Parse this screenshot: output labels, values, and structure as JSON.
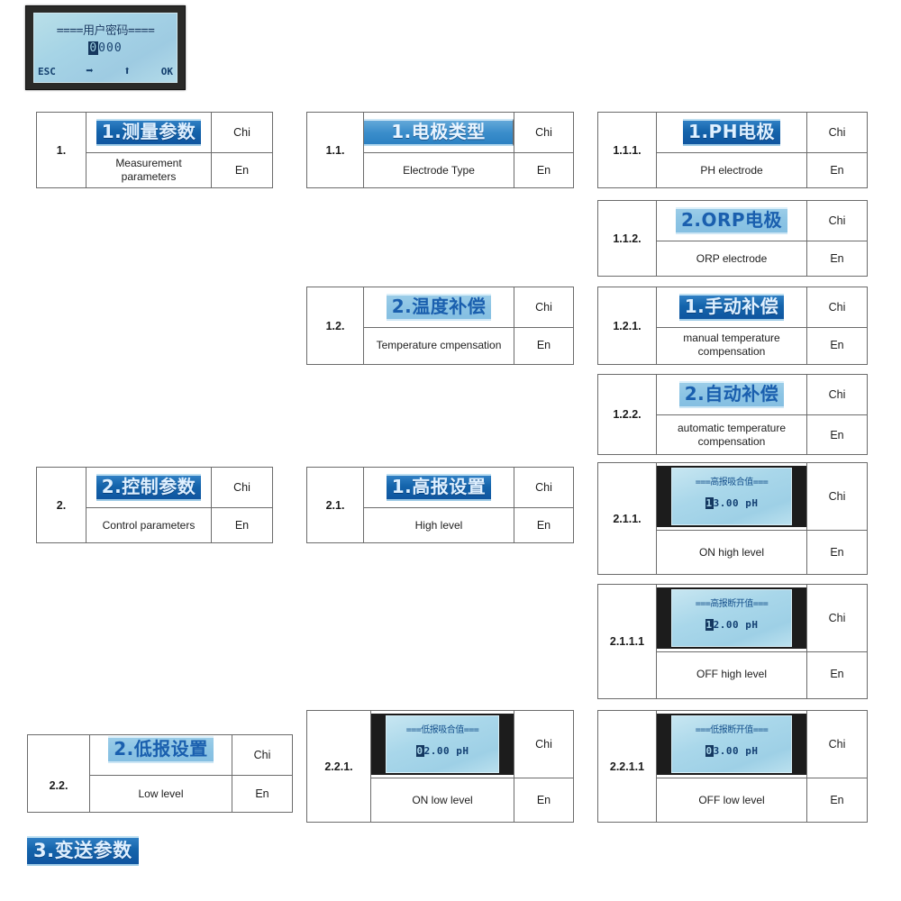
{
  "device_photo": {
    "title": "====用户密码====",
    "code_selected": "0",
    "code_rest": "000",
    "keys": {
      "esc": "ESC",
      "right": "➡",
      "up": "⬆",
      "ok": "OK"
    }
  },
  "columns_labels": {
    "chi": "Chi",
    "en": "En"
  },
  "menu": [
    {
      "id": "1",
      "index": "1.",
      "chi": "1.测量参数",
      "en": "Measurement parameters",
      "strip_style": "dark"
    },
    {
      "id": "1.1",
      "index": "1.1.",
      "chi": "1.电极类型",
      "en": "Electrode Type",
      "strip_style": "mid"
    },
    {
      "id": "1.1.1",
      "index": "1.1.1.",
      "chi": "1.PH电极",
      "en": "PH electrode",
      "strip_style": "dark"
    },
    {
      "id": "1.1.2",
      "index": "1.1.2.",
      "chi": "2.ORP电极",
      "en": "ORP electrode",
      "strip_style": "light"
    },
    {
      "id": "1.2",
      "index": "1.2.",
      "chi": "2.温度补偿",
      "en": "Temperature cmpensation",
      "strip_style": "light"
    },
    {
      "id": "1.2.1",
      "index": "1.2.1.",
      "chi": "1.手动补偿",
      "en": "manual temperature compensation",
      "strip_style": "dark"
    },
    {
      "id": "1.2.2",
      "index": "1.2.2.",
      "chi": "2.自动补偿",
      "en": "automatic temperature compensation",
      "strip_style": "light"
    },
    {
      "id": "2",
      "index": "2.",
      "chi": "2.控制参数",
      "en": "Control parameters",
      "strip_style": "dark"
    },
    {
      "id": "2.1",
      "index": "2.1.",
      "chi": "1.高报设置",
      "en": "High level",
      "strip_style": "dark"
    },
    {
      "id": "2.1.1",
      "index": "2.1.1.",
      "en": "ON high level",
      "photo": {
        "title": "===高报吸合值===",
        "value_selected": "1",
        "value_rest": "3.00 pH"
      }
    },
    {
      "id": "2.1.1.1",
      "index": "2.1.1.1",
      "en": "OFF high level",
      "photo": {
        "title": "===高报断开值===",
        "value_selected": "1",
        "value_rest": "2.00 pH"
      }
    },
    {
      "id": "2.2",
      "index": "2.2.",
      "chi": "2.低报设置",
      "en": "Low level",
      "strip_style": "light"
    },
    {
      "id": "2.2.1",
      "index": "2.2.1.",
      "en": "ON low level",
      "photo": {
        "title": "===低报吸合值===",
        "value_selected": "0",
        "value_rest": "2.00 pH"
      }
    },
    {
      "id": "2.2.1.1",
      "index": "2.2.1.1",
      "en": "OFF low level",
      "photo": {
        "title": "===低报断开值===",
        "value_selected": "0",
        "value_rest": "3.00 pH"
      }
    }
  ],
  "trailing_strip": {
    "chi": "3.变送参数"
  },
  "colors": {
    "lcd_background": "#a9d7ea",
    "lcd_text": "#15406e",
    "strip_dark": "#1464ab",
    "strip_mid": "#3b8ecb",
    "strip_light": "#8cc4e4",
    "border": "#6b6b6b",
    "page_background": "#ffffff"
  }
}
